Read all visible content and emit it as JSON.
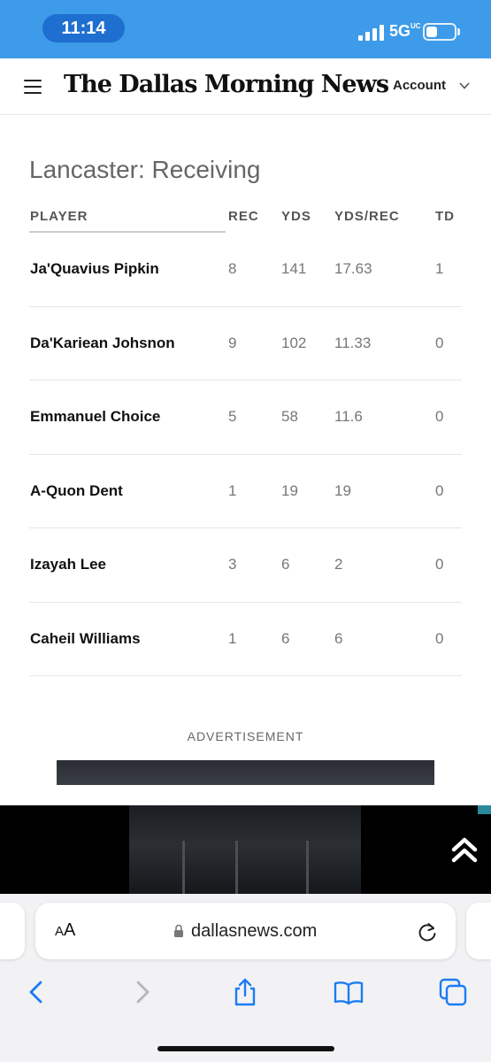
{
  "status_bar": {
    "time": "11:14",
    "network": "5G",
    "network_suffix": "UC",
    "colors": {
      "background": "#3d9be9",
      "pill": "#1f6fd0"
    }
  },
  "site_header": {
    "menu_icon": "hamburger-menu-icon",
    "masthead": "The Dallas Morning News",
    "account_label": "Account",
    "account_icon": "chevron-down-icon"
  },
  "stats": {
    "title": "Lancaster: Receiving",
    "columns": [
      "PLAYER",
      "REC",
      "YDS",
      "YDS/REC",
      "TD"
    ],
    "rows": [
      {
        "player": "Ja'Quavius Pipkin",
        "rec": "8",
        "yds": "141",
        "yds_rec": "17.63",
        "td": "1"
      },
      {
        "player": "Da'Kariean Johsnon",
        "rec": "9",
        "yds": "102",
        "yds_rec": "11.33",
        "td": "0"
      },
      {
        "player": "Emmanuel Choice",
        "rec": "5",
        "yds": "58",
        "yds_rec": "11.6",
        "td": "0"
      },
      {
        "player": "A-Quon Dent",
        "rec": "1",
        "yds": "19",
        "yds_rec": "19",
        "td": "0"
      },
      {
        "player": "Izayah Lee",
        "rec": "3",
        "yds": "6",
        "yds_rec": "2",
        "td": "0"
      },
      {
        "player": "Caheil Williams",
        "rec": "1",
        "yds": "6",
        "yds_rec": "6",
        "td": "0"
      }
    ]
  },
  "ad": {
    "label": "ADVERTISEMENT",
    "collapse_icon": "double-chevron-up-icon"
  },
  "browser": {
    "text_size_label_small": "A",
    "text_size_label_large": "A",
    "url": "dallasnews.com",
    "lock_icon": "lock-icon",
    "reload_icon": "reload-icon",
    "toolbar_icons": [
      "back-icon",
      "forward-icon",
      "share-icon",
      "bookmarks-icon",
      "tabs-icon"
    ],
    "accent_color": "#1a7cf5"
  }
}
